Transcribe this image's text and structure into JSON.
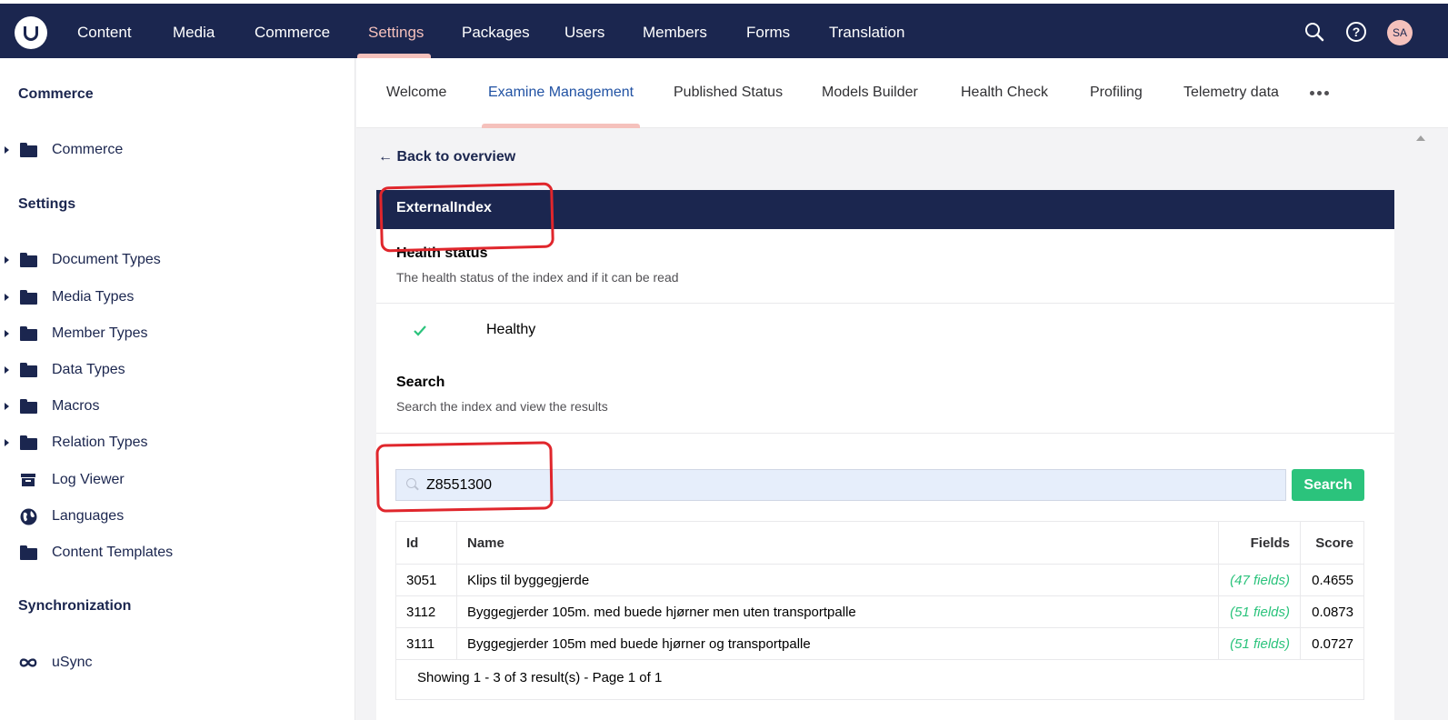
{
  "topnav": {
    "items": [
      {
        "label": "Content"
      },
      {
        "label": "Media"
      },
      {
        "label": "Commerce"
      },
      {
        "label": "Settings",
        "active": true
      },
      {
        "label": "Packages"
      },
      {
        "label": "Users"
      },
      {
        "label": "Members"
      },
      {
        "label": "Forms"
      },
      {
        "label": "Translation"
      }
    ],
    "avatar_initials": "SA"
  },
  "sidebar": {
    "sections": [
      {
        "title": "Commerce",
        "items": [
          {
            "label": "Commerce",
            "icon": "folder-icon",
            "expandable": true
          }
        ]
      },
      {
        "title": "Settings",
        "items": [
          {
            "label": "Document Types",
            "icon": "folder-icon",
            "expandable": true
          },
          {
            "label": "Media Types",
            "icon": "folder-icon",
            "expandable": true
          },
          {
            "label": "Member Types",
            "icon": "folder-icon",
            "expandable": true
          },
          {
            "label": "Data Types",
            "icon": "folder-icon",
            "expandable": true
          },
          {
            "label": "Macros",
            "icon": "folder-icon",
            "expandable": true
          },
          {
            "label": "Relation Types",
            "icon": "folder-icon",
            "expandable": true
          },
          {
            "label": "Log Viewer",
            "icon": "archive-icon",
            "expandable": false
          },
          {
            "label": "Languages",
            "icon": "globe-icon",
            "expandable": false
          },
          {
            "label": "Content Templates",
            "icon": "folder-icon",
            "expandable": false
          }
        ]
      },
      {
        "title": "Synchronization",
        "items": [
          {
            "label": "uSync",
            "icon": "infinity-icon",
            "expandable": false
          }
        ]
      }
    ]
  },
  "tabs": [
    {
      "label": "Welcome"
    },
    {
      "label": "Examine Management",
      "active": true
    },
    {
      "label": "Published Status"
    },
    {
      "label": "Models Builder"
    },
    {
      "label": "Health Check"
    },
    {
      "label": "Profiling"
    },
    {
      "label": "Telemetry data"
    }
  ],
  "back_link": "← Back to overview",
  "index": {
    "name": "ExternalIndex",
    "health": {
      "title": "Health status",
      "description": "The health status of the index and if it can be read",
      "status": "Healthy"
    },
    "search": {
      "title": "Search",
      "description": "Search the index and view the results",
      "query": "Z8551300",
      "button_label": "Search"
    },
    "results": {
      "columns": [
        "Id",
        "Name",
        "Fields",
        "Score"
      ],
      "rows": [
        {
          "id": "3051",
          "name": "Klips til byggegjerde",
          "fields": "(47 fields)",
          "score": "0.4655"
        },
        {
          "id": "3112",
          "name": "Byggegjerder 105m. med buede hjørner men uten transportpalle",
          "fields": "(51 fields)",
          "score": "0.0873"
        },
        {
          "id": "3111",
          "name": "Byggegjerder 105m med buede hjørner og transportpalle",
          "fields": "(51 fields)",
          "score": "0.0727"
        }
      ],
      "pager": "Showing 1 - 3 of 3 result(s) - Page 1 of 1"
    }
  },
  "colors": {
    "header_bg": "#1b264f",
    "active_accent": "#f5c1bc",
    "success": "#2bc37c",
    "annotation": "#e0262c"
  }
}
